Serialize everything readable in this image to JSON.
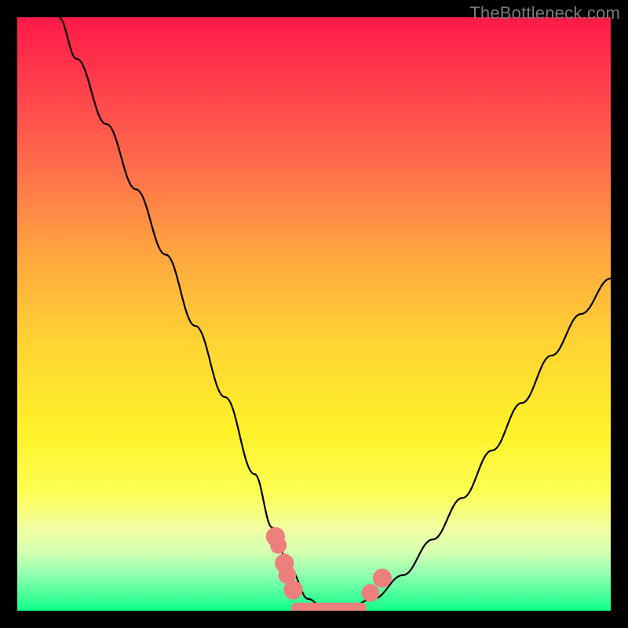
{
  "watermark": "TheBottleneck.com",
  "chart_data": {
    "type": "line",
    "title": "",
    "xlabel": "",
    "ylabel": "",
    "xlim": [
      0,
      100
    ],
    "ylim": [
      0,
      100
    ],
    "series": [
      {
        "name": "bottleneck-curve",
        "x": [
          7,
          10,
          15,
          20,
          25,
          30,
          35,
          40,
          43,
          46,
          49,
          52,
          55,
          60,
          65,
          70,
          75,
          80,
          85,
          90,
          95,
          100
        ],
        "y": [
          100,
          93,
          82,
          71,
          60,
          48,
          36,
          23,
          14,
          7,
          2,
          0,
          0,
          2,
          6,
          12,
          19,
          27,
          35,
          43,
          50,
          56
        ]
      }
    ],
    "flat_region": {
      "x_start": 47,
      "x_end": 58,
      "y": 0.5
    },
    "beads": [
      {
        "x": 43.5,
        "y": 12.5,
        "r": 1.6
      },
      {
        "x": 44.0,
        "y": 11.0,
        "r": 1.4
      },
      {
        "x": 45.0,
        "y": 8.0,
        "r": 1.6
      },
      {
        "x": 45.5,
        "y": 6.0,
        "r": 1.5
      },
      {
        "x": 46.5,
        "y": 3.5,
        "r": 1.6
      },
      {
        "x": 59.5,
        "y": 3.0,
        "r": 1.5
      },
      {
        "x": 61.5,
        "y": 5.5,
        "r": 1.6
      }
    ]
  }
}
